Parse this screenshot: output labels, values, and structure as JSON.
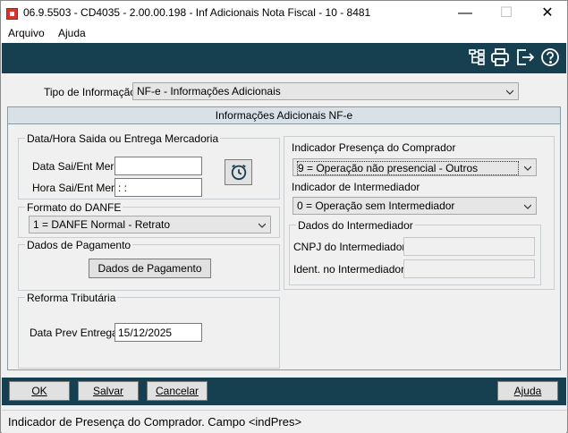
{
  "window": {
    "title": "06.9.5503 - CD4035 - 2.00.00.198 - Inf Adicionais Nota Fiscal - 10 - 8481",
    "minimize": "—",
    "maximize": "☐",
    "close": "✕"
  },
  "menu": {
    "arquivo": "Arquivo",
    "ajuda": "Ajuda"
  },
  "toolbar": {
    "icons": [
      "tree-structure-icon",
      "printer-icon",
      "exit-icon",
      "help-icon"
    ]
  },
  "tipo": {
    "label": "Tipo de Informação:",
    "value": "NF-e - Informações Adicionais"
  },
  "panel": {
    "title": "Informações Adicionais NF-e"
  },
  "datahora": {
    "title": "Data/Hora Saida ou Entrega Mercadoria",
    "data_label": "Data Sai/Ent Merc:",
    "data_value": "",
    "hora_label": "Hora Sai/Ent Merc:",
    "hora_value": " :  :"
  },
  "danfe": {
    "title": "Formato do DANFE",
    "value": "1 = DANFE Normal - Retrato"
  },
  "pagamento": {
    "title": "Dados de Pagamento",
    "button": "Dados de Pagamento"
  },
  "reforma": {
    "title": "Reforma Tributária",
    "label": "Data Prev Entrega:",
    "value": "15/12/2025"
  },
  "presenca": {
    "title": "Indicador Presença do Comprador",
    "value": "9 = Operação não presencial - Outros"
  },
  "intermediador": {
    "title": "Indicador de Intermediador",
    "value": "0 = Operação sem Intermediador"
  },
  "dados_intermediador": {
    "title": "Dados do Intermediador",
    "cnpj_label": "CNPJ do Intermediador:",
    "cnpj_value": "",
    "ident_label": "Ident. no Intermediador:",
    "ident_value": ""
  },
  "buttons": {
    "ok": "OK",
    "salvar": "Salvar",
    "cancelar": "Cancelar",
    "ajuda": "Ajuda"
  },
  "status": "Indicador de Presença do Comprador. Campo <indPres>"
}
